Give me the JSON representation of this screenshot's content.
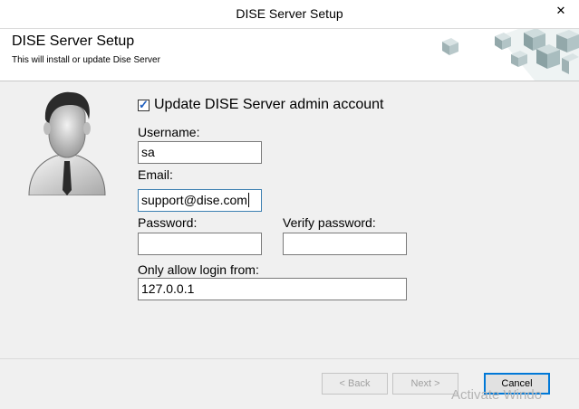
{
  "window": {
    "title": "DISE Server Setup",
    "close_glyph": "✕"
  },
  "header": {
    "title": "DISE Server Setup",
    "subtitle": "This will install or update Dise Server"
  },
  "form": {
    "update_checkbox": {
      "label": "Update DISE Server admin account",
      "checked": true
    },
    "username": {
      "label": "Username:",
      "value": "sa"
    },
    "email": {
      "label": "Email:",
      "value": "support@dise.com"
    },
    "password": {
      "label": "Password:",
      "value": ""
    },
    "verify_password": {
      "label": "Verify password:",
      "value": ""
    },
    "allow_from": {
      "label": "Only allow login from:",
      "value": "127.0.0.1"
    }
  },
  "buttons": {
    "back": "< Back",
    "next": "Next >",
    "cancel": "Cancel"
  },
  "watermark": "Activate Windo",
  "icons": {
    "avatar": "user-avatar-icon",
    "cubes": "cubes-logo-icon"
  },
  "colors": {
    "accent": "#0078d7",
    "checkmark": "#1f5fbf"
  }
}
